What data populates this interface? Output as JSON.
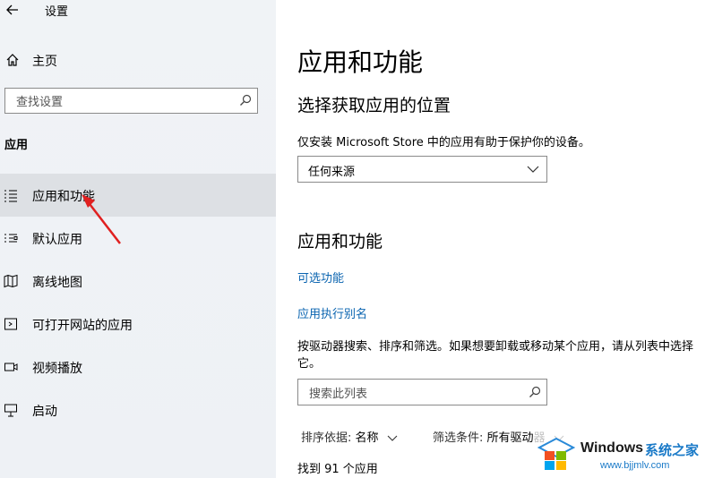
{
  "window": {
    "title": "设置"
  },
  "sidebar": {
    "home_label": "主页",
    "search_placeholder": "查找设置",
    "section_label": "应用",
    "items": [
      {
        "label": "应用和功能",
        "icon": "apps-list-icon",
        "selected": true
      },
      {
        "label": "默认应用",
        "icon": "default-apps-icon",
        "selected": false
      },
      {
        "label": "离线地图",
        "icon": "offline-map-icon",
        "selected": false
      },
      {
        "label": "可打开网站的应用",
        "icon": "apps-for-websites-icon",
        "selected": false
      },
      {
        "label": "视频播放",
        "icon": "video-playback-icon",
        "selected": false
      },
      {
        "label": "启动",
        "icon": "startup-icon",
        "selected": false
      }
    ]
  },
  "main": {
    "title": "应用和功能",
    "install_section": {
      "heading": "选择获取应用的位置",
      "description": "仅安装 Microsoft Store 中的应用有助于保护你的设备。",
      "dropdown_value": "任何来源"
    },
    "apps_section": {
      "heading": "应用和功能",
      "link_optional": "可选功能",
      "link_alias": "应用执行别名",
      "paragraph": "按驱动器搜索、排序和筛选。如果想要卸载或移动某个应用，请从列表中选择它。",
      "search_placeholder": "搜索此列表",
      "sort_label": "排序依据:",
      "sort_value": "名称",
      "filter_label": "筛选条件:",
      "filter_value": "所有驱动器",
      "count_text": "找到 91 个应用"
    }
  },
  "watermark": {
    "brand": "Windows",
    "site_name": "系统之家",
    "url": "www.bjjmlv.com"
  },
  "colors": {
    "accent_link": "#0a64b0",
    "selected_bg": "#dde0e4",
    "annotation_arrow": "#e02020"
  }
}
